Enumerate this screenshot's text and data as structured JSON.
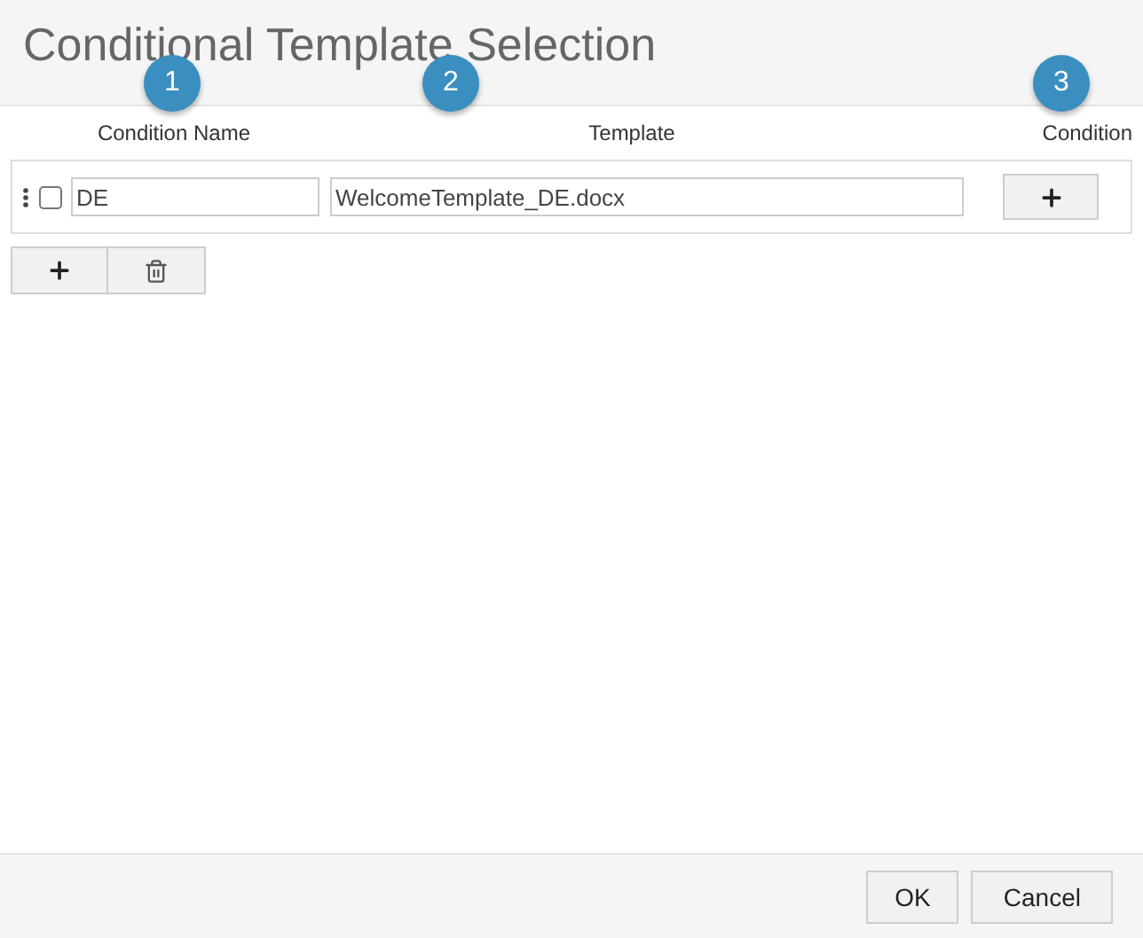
{
  "dialog": {
    "title": "Conditional Template Selection"
  },
  "callouts": [
    {
      "label": "1"
    },
    {
      "label": "2"
    },
    {
      "label": "3"
    }
  ],
  "columns": [
    "Condition Name",
    "Template",
    "Condition"
  ],
  "rows": [
    {
      "checked": false,
      "name": "DE",
      "template": "WelcomeTemplate_DE.docx"
    }
  ],
  "footer": {
    "buttons": [
      "OK",
      "Cancel"
    ]
  }
}
